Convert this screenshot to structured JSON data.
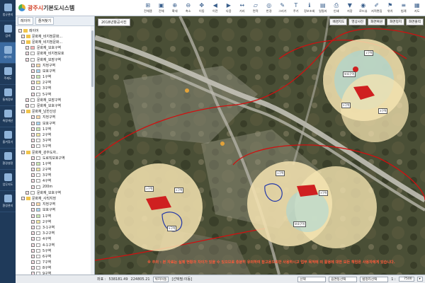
{
  "app": {
    "city": "광주시",
    "title": "기본도시스템"
  },
  "left_nav": [
    {
      "label": "법규관리",
      "icon": "building-icon"
    },
    {
      "label": "검색",
      "icon": "search-icon"
    },
    {
      "label": "레이어",
      "icon": "layers-icon"
    },
    {
      "label": "주제도",
      "icon": "map-icon"
    },
    {
      "label": "통계정보",
      "icon": "stats-icon"
    },
    {
      "label": "측량계산",
      "icon": "calc-icon"
    },
    {
      "label": "즐겨찾기",
      "icon": "star-icon"
    },
    {
      "label": "환경설정",
      "icon": "gear-icon"
    },
    {
      "label": "업무지도",
      "icon": "folder-icon"
    },
    {
      "label": "환경관리",
      "icon": "tree-icon"
    }
  ],
  "toolbar": [
    {
      "label": "전체맵",
      "glyph": "⊞"
    },
    {
      "label": "전체",
      "glyph": "▣"
    },
    {
      "label": "확대",
      "glyph": "⊕"
    },
    {
      "label": "축소",
      "glyph": "⊖"
    },
    {
      "label": "이동",
      "glyph": "✥"
    },
    {
      "label": "이전",
      "glyph": "◀"
    },
    {
      "label": "다음",
      "glyph": "▶"
    },
    {
      "label": "거리",
      "glyph": "↔"
    },
    {
      "label": "면적",
      "glyph": "▱"
    },
    {
      "label": "반경",
      "glyph": "◎"
    },
    {
      "label": "그리기",
      "glyph": "✎"
    },
    {
      "label": "주기",
      "glyph": "T"
    },
    {
      "label": "정보조회",
      "glyph": "ℹ"
    },
    {
      "label": "일필지",
      "glyph": "▤"
    },
    {
      "label": "인쇄",
      "glyph": "⎙"
    },
    {
      "label": "저장",
      "glyph": "▼"
    },
    {
      "label": "로드뷰",
      "glyph": "◉"
    },
    {
      "label": "지적편집",
      "glyph": "✐"
    },
    {
      "label": "위치",
      "glyph": "⚑"
    },
    {
      "label": "범례",
      "glyph": "≡"
    },
    {
      "label": "지도",
      "glyph": "▦"
    },
    {
      "label": "사진",
      "glyph": "▩"
    },
    {
      "label": "도움말",
      "glyph": "?"
    }
  ],
  "panel": {
    "tabs": [
      "레이어",
      "즐겨찾기"
    ],
    "tree": [
      {
        "label": "레이어",
        "level": 0,
        "folder": true
      },
      {
        "label": "문화재_비지정문화...",
        "level": 1,
        "folder": true
      },
      {
        "label": "문화재_비지정문화...",
        "level": 1,
        "folder": true
      },
      {
        "label": "문화재_보호구역",
        "level": 2,
        "color": "#ffb3b3"
      },
      {
        "label": "문화재_비지정보호",
        "level": 2,
        "color": "#ffffff"
      },
      {
        "label": "문화재_보장구역",
        "level": 2,
        "color": "#ffffff"
      },
      {
        "label": "지정구역",
        "level": 3,
        "color": "#f8d7a6"
      },
      {
        "label": "보호구역",
        "level": 3,
        "color": "#a8d4f0"
      },
      {
        "label": "1구역",
        "level": 3,
        "color": "#c9e8b0"
      },
      {
        "label": "2구역",
        "level": 3,
        "color": "#f1e7a0"
      },
      {
        "label": "3구역",
        "level": 3,
        "color": "#ffffff"
      },
      {
        "label": "5구역",
        "level": 3,
        "color": "#ffffff"
      },
      {
        "label": "문화재_보장구역",
        "level": 2,
        "color": "#ffffff"
      },
      {
        "label": "문화재_보호구역",
        "level": 2,
        "color": "#ffffff"
      },
      {
        "label": "문화재_남한산성",
        "level": 1,
        "folder": true
      },
      {
        "label": "지정구역",
        "level": 3,
        "color": "#f8d7a6"
      },
      {
        "label": "보호구역",
        "level": 3,
        "color": "#a8d4f0"
      },
      {
        "label": "1구역",
        "level": 3,
        "color": "#c9e8b0"
      },
      {
        "label": "2구역",
        "level": 3,
        "color": "#f1e7a0"
      },
      {
        "label": "3구역",
        "level": 3,
        "color": "#ffffff"
      },
      {
        "label": "5구역",
        "level": 3,
        "color": "#ffffff"
      },
      {
        "label": "문화재_광주도자..",
        "level": 1,
        "folder": true
      },
      {
        "label": "도로직보호구역",
        "level": 3,
        "color": "#ffffff"
      },
      {
        "label": "1구역",
        "level": 3,
        "color": "#c9e8b0"
      },
      {
        "label": "2구역",
        "level": 3,
        "color": "#f1e7a0"
      },
      {
        "label": "3구역",
        "level": 3,
        "color": "#ffffff"
      },
      {
        "label": "4구역",
        "level": 3,
        "color": "#ffffff"
      },
      {
        "label": "200m",
        "level": 3,
        "color": "#ffffff"
      },
      {
        "label": "문화재_보호구역",
        "level": 2,
        "color": "#ffffff"
      },
      {
        "label": "문화재_사직지정",
        "level": 1,
        "folder": true
      },
      {
        "label": "지정구역",
        "level": 3,
        "color": "#f8d7a6"
      },
      {
        "label": "보호구역",
        "level": 3,
        "color": "#a8d4f0"
      },
      {
        "label": "1구역",
        "level": 3,
        "color": "#c9e8b0"
      },
      {
        "label": "2구역",
        "level": 3,
        "color": "#f1e7a0"
      },
      {
        "label": "3-1구역",
        "level": 3,
        "color": "#ffffff"
      },
      {
        "label": "3-2구역",
        "level": 3,
        "color": "#ffffff"
      },
      {
        "label": "4구역",
        "level": 3,
        "color": "#ffffff"
      },
      {
        "label": "4-1구역",
        "level": 3,
        "color": "#ffffff"
      },
      {
        "label": "5구역",
        "level": 3,
        "color": "#ffffff"
      },
      {
        "label": "6구역",
        "level": 3,
        "color": "#ffffff"
      },
      {
        "label": "7구역",
        "level": 3,
        "color": "#ffffff"
      },
      {
        "label": "8구역",
        "level": 3,
        "color": "#ffffff"
      },
      {
        "label": "9구역",
        "level": 3,
        "color": "#ffffff"
      }
    ]
  },
  "map": {
    "title": "2018년항공사진",
    "buttons": [
      "배경지도",
      "영상사진",
      "화면복원",
      "화면정지",
      "화면출력"
    ],
    "notice": "※ 주의 : 본 자료는 실제 현황과 차이가 있을 수 있으므로 충분히 유의하여 참고용으로만 사용하시고 업무 목적에 의 활용에 대한 모든 책임은 사용자에게 있습니다."
  },
  "status_bar": {
    "coord_label": "좌표 :",
    "x": "538181.49",
    "y": "224805.21",
    "btn_pos": "위치이동",
    "select_label": "[선택필:이동]",
    "sel1": "선택",
    "sel2": "읍면동선택",
    "sel3": "법정리선택",
    "scale_label": "1 :",
    "scale": "7500"
  },
  "zone_labels": [
    "1구역",
    "2구역",
    "3구역",
    "보호구역",
    "5구역"
  ]
}
